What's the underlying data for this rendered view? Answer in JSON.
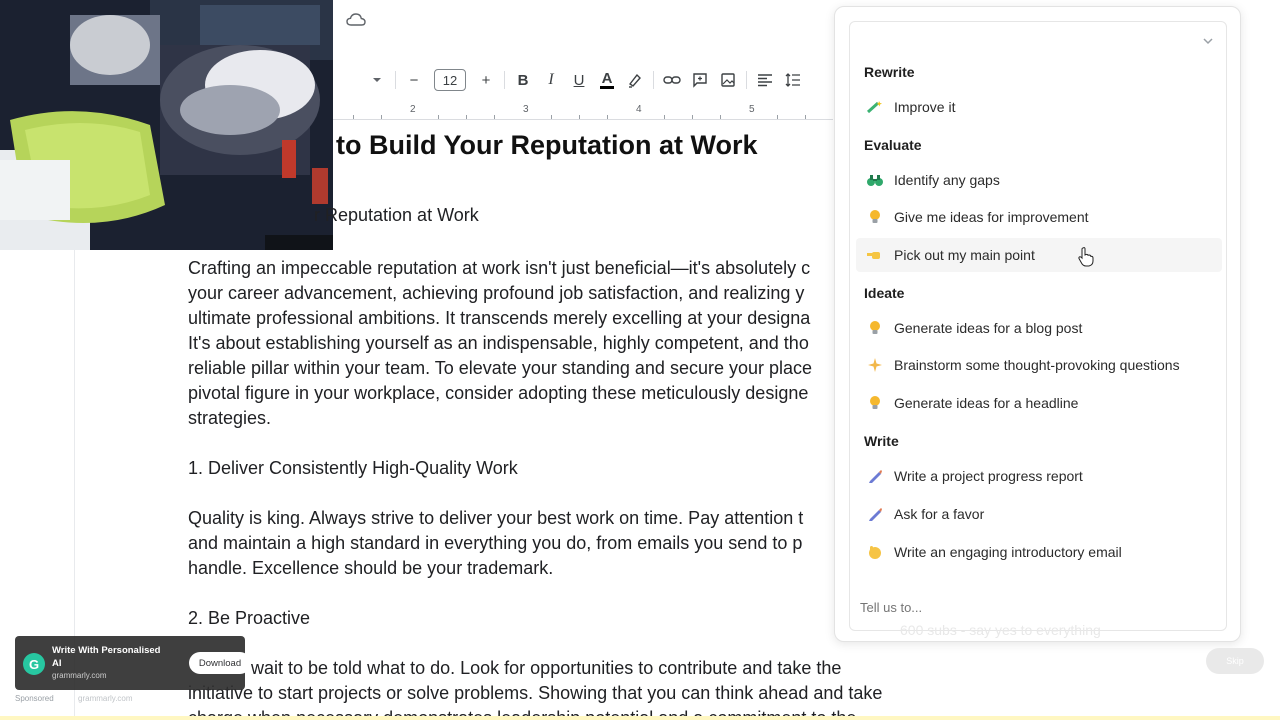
{
  "toolbar": {
    "font_size": "12",
    "undo_icon": "minus-icon",
    "buttons": [
      "minus-icon",
      "plus-icon",
      "bold-icon",
      "italic-icon",
      "underline-icon",
      "text-color-icon",
      "highlight-icon",
      "link-icon",
      "comment-icon",
      "image-icon",
      "align-icon",
      "line-spacing-icon"
    ],
    "bold": "B",
    "italic": "I",
    "underline": "U",
    "text_color": "A",
    "minus": "−",
    "plus": "+"
  },
  "ruler": {
    "marks": [
      "2",
      "3",
      "4",
      "5"
    ]
  },
  "document": {
    "title": "to Build Your Reputation at Work",
    "subtitle": "r Reputation at Work",
    "paragraphs": [
      "Crafting an impeccable reputation at work isn't just beneficial—it's absolutely c",
      "your career advancement, achieving profound job satisfaction, and realizing y",
      "ultimate professional ambitions. It transcends merely excelling at your designa",
      "It's about establishing yourself as an indispensable, highly competent, and tho",
      "reliable pillar within your team. To elevate your standing and secure your place",
      "pivotal figure in your workplace, consider adopting these meticulously designe",
      "strategies."
    ],
    "heading1": "1. Deliver Consistently High-Quality Work",
    "paragraph2": [
      "Quality is king. Always strive to deliver your best work on time. Pay attention t",
      "and maintain a high standard in everything you do, from emails you send to p",
      "handle. Excellence should be your trademark."
    ],
    "heading2": "2. Be Proactive",
    "paragraph3": [
      "wait to be told what to do. Look for opportunities to contribute and take the",
      "initiative to start projects or solve problems. Showing that you can think ahead and take",
      "charge when necessary demonstrates leadership potential and a commitment to the"
    ]
  },
  "ai_panel": {
    "sections": [
      {
        "heading": "Rewrite",
        "items": [
          {
            "label": "Improve it",
            "icon": "magic-wand-icon"
          }
        ]
      },
      {
        "heading": "Evaluate",
        "items": [
          {
            "label": "Identify any gaps",
            "icon": "binoculars-icon"
          },
          {
            "label": "Give me ideas for improvement",
            "icon": "lightbulb-icon"
          },
          {
            "label": "Pick out my main point",
            "icon": "pointing-hand-icon"
          }
        ]
      },
      {
        "heading": "Ideate",
        "items": [
          {
            "label": "Generate ideas for a blog post",
            "icon": "lightbulb-icon"
          },
          {
            "label": "Brainstorm some thought-provoking questions",
            "icon": "sparkle-icon"
          },
          {
            "label": "Generate ideas for a headline",
            "icon": "lightbulb-icon"
          }
        ]
      },
      {
        "heading": "Write",
        "items": [
          {
            "label": "Write a project progress report",
            "icon": "pen-icon"
          },
          {
            "label": "Ask for a favor",
            "icon": "pen-icon"
          },
          {
            "label": "Write an engaging introductory email",
            "icon": "waving-hand-icon"
          }
        ]
      }
    ],
    "input_placeholder": "Tell us to..."
  },
  "ad": {
    "title": "Write With Personalised AI",
    "domain": "grammarly.com",
    "button": "Download",
    "logo": "G",
    "sponsored": "Sponsored",
    "domain_footer": "grammarly.com"
  },
  "overlay": {
    "faint_text": "600 subs - say yes to everything",
    "skip": "Skip"
  }
}
